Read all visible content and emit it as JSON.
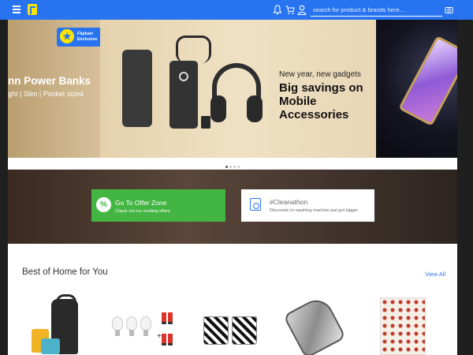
{
  "topbar": {
    "search_placeholder": "search for product & brands here...",
    "colors": {
      "bar": "#2874f0",
      "logo": "#ffe500"
    },
    "icons": [
      "menu-icon",
      "logo-icon",
      "notification-bell-icon",
      "cart-icon",
      "user-icon",
      "camera-icon"
    ]
  },
  "banner": {
    "badge_line1": "Flipkart",
    "badge_line2": "Exclusive",
    "left_title": "nn Power Banks",
    "left_subtitle": "ght | Slim | Pocket sized",
    "promo_small": "New year, new gadgets",
    "promo_big": "Big savings on Mobile Accessories",
    "slide_count": 4,
    "active_slide": 1
  },
  "offers": {
    "card1": {
      "title": "Go To Offer Zone",
      "subtitle": "Check out our exciting offers",
      "icon": "percent-icon",
      "symbol": "%",
      "color": "#43b543"
    },
    "card2": {
      "title": "#Cleanathon",
      "subtitle": "Discounts on washing machine just got bigger",
      "icon": "washing-machine-icon"
    }
  },
  "products_section": {
    "title": "Best of Home for You",
    "view_all": "View All",
    "items": [
      {
        "name": "tiffin-set"
      },
      {
        "name": "led-bulbs-batteries"
      },
      {
        "name": "printed-mugs"
      },
      {
        "name": "hip-flask"
      },
      {
        "name": "bed-sheet"
      }
    ]
  }
}
